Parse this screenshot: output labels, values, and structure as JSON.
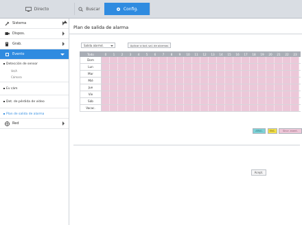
{
  "topbar": {
    "tabs": [
      {
        "label": "Directo",
        "icon": "monitor-icon",
        "active": false
      },
      {
        "label": "Buscar",
        "icon": "search-icon",
        "active": false
      },
      {
        "label": "Config.",
        "icon": "gear-icon",
        "active": true
      }
    ]
  },
  "sidebar": {
    "items": [
      {
        "label": "Sistema",
        "icon": "wrench-icon"
      },
      {
        "label": "Dispos.",
        "icon": "camera-icon"
      },
      {
        "label": "Grab.",
        "icon": "record-icon"
      },
      {
        "label": "Evento",
        "icon": "event-icon",
        "active": true
      }
    ],
    "event_sub": {
      "deteccion": "Detección de sensor",
      "alarma": "Ve/A",
      "camara": "Cámara",
      "ev_cam": "Ev cám",
      "det_perdida": "Det. de pérdida de vídeo",
      "plan_salida": "Plan de salida de alarma"
    },
    "red": {
      "label": "Red",
      "icon": "network-icon"
    }
  },
  "content": {
    "title": "Plan de salida de alarma",
    "select_value": "Salida alarmd.",
    "apply_all_label": "Aplicar a tod. sal. de alarmas",
    "grid": {
      "day_header": "Todo",
      "hours": [
        "0",
        "1",
        "2",
        "3",
        "4",
        "5",
        "6",
        "7",
        "8",
        "9",
        "10",
        "11",
        "12",
        "13",
        "14",
        "15",
        "16",
        "17",
        "18",
        "19",
        "20",
        "21",
        "22",
        "23"
      ],
      "days": [
        "Dom",
        "Lun",
        "Mar",
        "Mié",
        "Jue",
        "Vie",
        "Sáb",
        "Vacac."
      ]
    },
    "legend": {
      "on": "APAG.",
      "off": "ENC.",
      "sync": "Sincr. event."
    },
    "apply_label": "Acept."
  },
  "colors": {
    "accent": "#2f8be0",
    "cell_fill": "#ecc8d9",
    "legend_on": "#7dd3d8",
    "legend_off": "#f4e14a",
    "legend_sync": "#eec7d8"
  }
}
